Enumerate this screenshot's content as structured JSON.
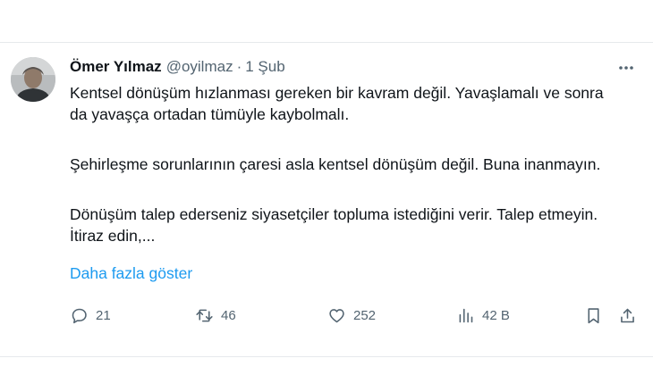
{
  "tweet": {
    "author_name": "Ömer Yılmaz",
    "handle": "@oyilmaz",
    "separator": "·",
    "date": "1 Şub",
    "paragraphs": [
      "Kentsel dönüşüm hızlanması gereken bir kavram değil. Yavaşlamalı ve sonra da yavaşça ortadan tümüyle kaybolmalı.",
      "Şehirleşme sorunlarının çaresi asla kentsel dönüşüm değil. Buna inanmayın.",
      "Dönüşüm talep ederseniz siyasetçiler topluma istediğini verir. Talep etmeyin. İtiraz edin,..."
    ],
    "show_more": "Daha fazla göster"
  },
  "actions": {
    "replies": "21",
    "reposts": "46",
    "likes": "252",
    "views": "42 B"
  },
  "colors": {
    "text": "#0f1419",
    "secondary": "#536471",
    "link": "#1d9bf0",
    "border": "#e6e9ec"
  },
  "icons": [
    "more-icon",
    "reply-icon",
    "repost-icon",
    "like-icon",
    "views-icon",
    "bookmark-icon",
    "share-icon"
  ]
}
